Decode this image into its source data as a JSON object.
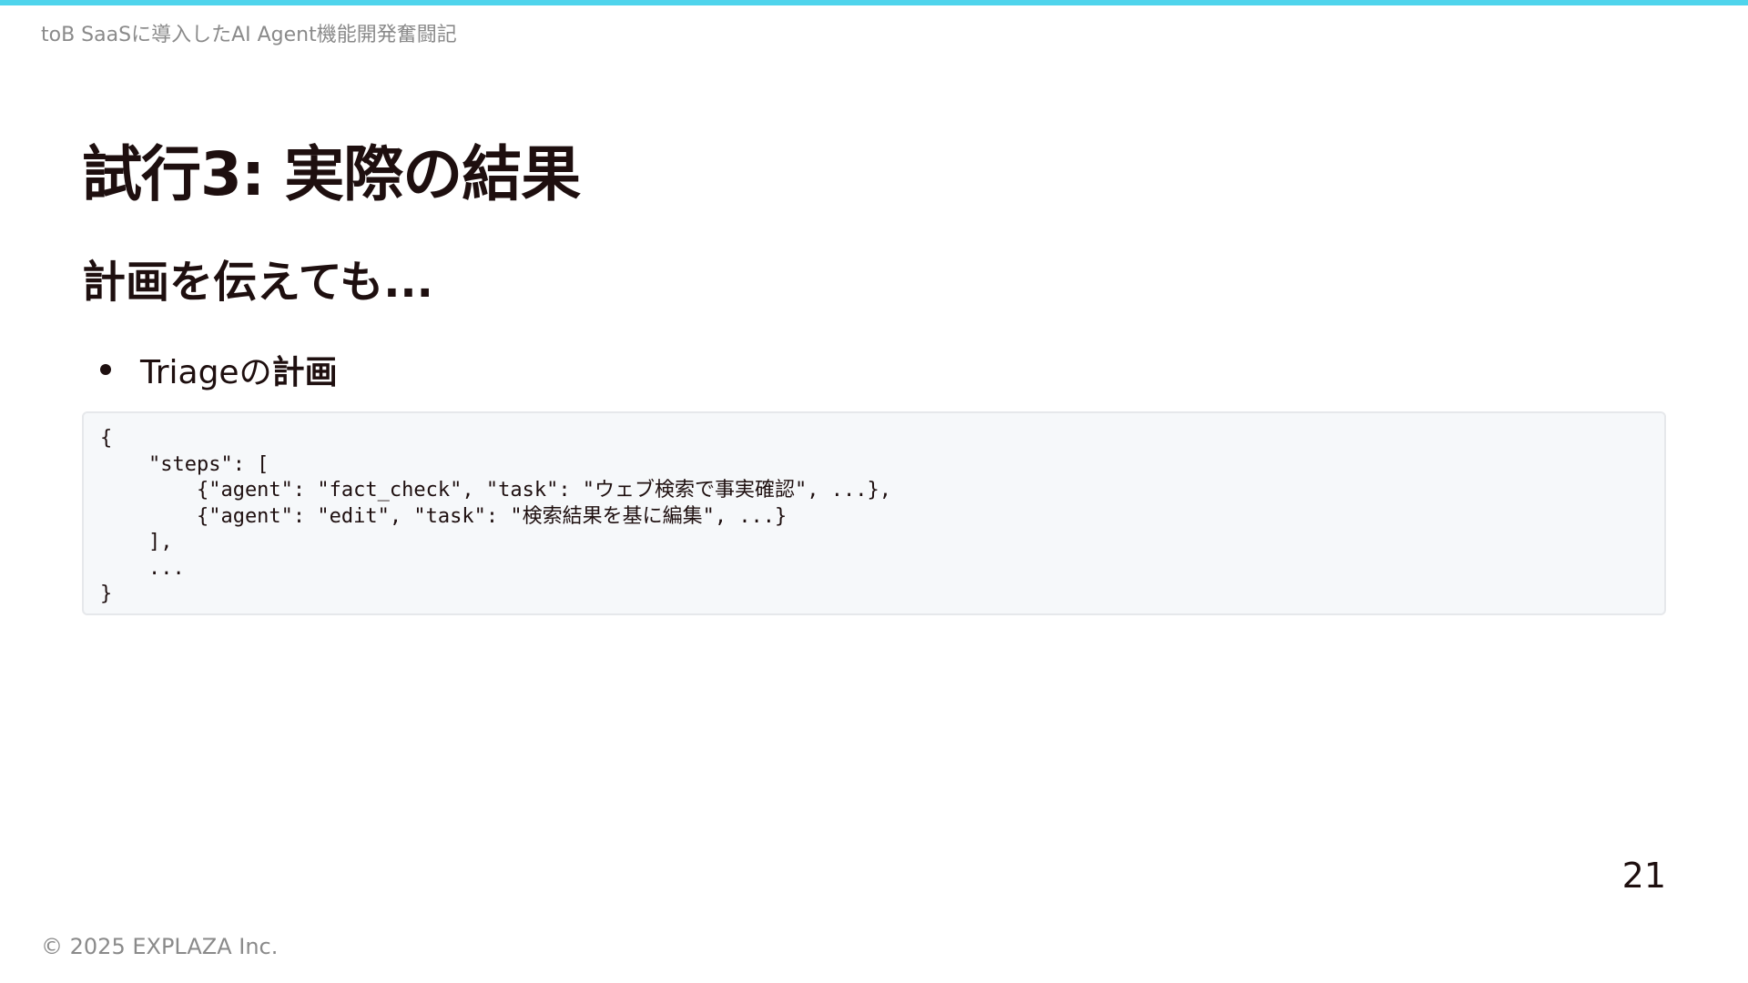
{
  "header": {
    "deck_title": "toB SaaSに導入したAI Agent機能開発奮闘記"
  },
  "slide": {
    "title": "試行3: 実際の結果",
    "subtitle": "計画を伝えても...",
    "bullets": [
      {
        "text": "Triageの",
        "strong": "計画"
      }
    ],
    "code": "{\n    \"steps\": [\n        {\"agent\": \"fact_check\", \"task\": \"ウェブ検索で事実確認\", ...},\n        {\"agent\": \"edit\", \"task\": \"検索結果を基に編集\", ...}\n    ],\n    ...\n}",
    "page_number": "21"
  },
  "footer": {
    "copyright": "© 2025 EXPLAZA Inc."
  },
  "colors": {
    "accent_bar": "#4fd4ec",
    "text": "#1e0f0f",
    "muted_text": "#8a8a8a",
    "code_background": "#f6f8fa"
  }
}
